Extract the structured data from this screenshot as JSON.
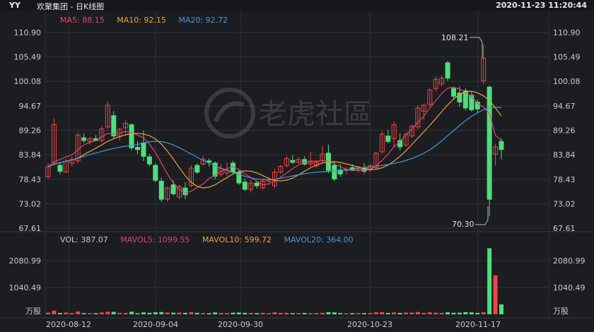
{
  "header": {
    "ticker": "YY",
    "name": "欢聚集团 - 日K线图",
    "datetime": "2020-11-23 11:20:44"
  },
  "price_legend": {
    "ma5": "MA5: 88.15",
    "ma10": "MA10: 92.15",
    "ma20": "MA20: 92.72"
  },
  "volume_legend": {
    "vol": "VOL: 387.07",
    "mavol5": "MAVOL5: 1099.55",
    "mavol10": "MAVOL10: 599.72",
    "mavol20": "MAVOL20: 364.00"
  },
  "watermark": "老虎社區",
  "price_axis": [
    "110.90",
    "105.49",
    "100.08",
    "94.67",
    "89.26",
    "83.84",
    "78.43",
    "73.02",
    "67.61"
  ],
  "volume_axis": [
    "2080.99",
    "1040.49",
    "万股"
  ],
  "date_labels": [
    "2020-08-12",
    "2020-09-04",
    "2020-09-30",
    "2020-10-23",
    "2020-11-17"
  ],
  "annotations": {
    "high": "108.21",
    "low": "70.30"
  },
  "colors": {
    "up": "#ee4444",
    "down": "#4ae07a",
    "ma5": "#e0456f",
    "ma10": "#f0a13a",
    "ma20": "#3d9ae0",
    "grid": "#2e3036",
    "bg": "#1c1d21"
  },
  "chart_data": {
    "type": "candlestick",
    "price_ylim": [
      67.61,
      110.9
    ],
    "volume_ylim": [
      0,
      2600
    ],
    "candles": [
      {
        "o": 79.0,
        "h": 82.0,
        "l": 78.5,
        "c": 81.2
      },
      {
        "o": 82.0,
        "h": 91.8,
        "l": 81.5,
        "c": 90.5
      },
      {
        "o": 81.5,
        "h": 82.3,
        "l": 79.5,
        "c": 80.2
      },
      {
        "o": 80.0,
        "h": 83.0,
        "l": 79.8,
        "c": 82.4
      },
      {
        "o": 82.0,
        "h": 83.5,
        "l": 81.2,
        "c": 82.8
      },
      {
        "o": 82.5,
        "h": 88.8,
        "l": 82.0,
        "c": 88.2
      },
      {
        "o": 87.6,
        "h": 88.6,
        "l": 86.4,
        "c": 87.0
      },
      {
        "o": 86.8,
        "h": 87.8,
        "l": 86.1,
        "c": 87.4
      },
      {
        "o": 87.4,
        "h": 88.2,
        "l": 86.8,
        "c": 87.0
      },
      {
        "o": 87.0,
        "h": 90.2,
        "l": 86.5,
        "c": 89.6
      },
      {
        "o": 90.0,
        "h": 95.6,
        "l": 89.5,
        "c": 94.8
      },
      {
        "o": 92.5,
        "h": 93.5,
        "l": 87.3,
        "c": 88.0
      },
      {
        "o": 88.0,
        "h": 89.8,
        "l": 87.0,
        "c": 89.5
      },
      {
        "o": 89.8,
        "h": 91.6,
        "l": 88.3,
        "c": 90.8
      },
      {
        "o": 90.5,
        "h": 90.8,
        "l": 84.8,
        "c": 85.4
      },
      {
        "o": 85.5,
        "h": 86.8,
        "l": 84.0,
        "c": 85.0
      },
      {
        "o": 86.5,
        "h": 89.2,
        "l": 82.5,
        "c": 83.5
      },
      {
        "o": 83.4,
        "h": 84.0,
        "l": 81.3,
        "c": 81.8
      },
      {
        "o": 81.5,
        "h": 82.0,
        "l": 77.8,
        "c": 78.2
      },
      {
        "o": 78.0,
        "h": 78.8,
        "l": 73.4,
        "c": 74.0
      },
      {
        "o": 74.0,
        "h": 76.8,
        "l": 73.4,
        "c": 76.5
      },
      {
        "o": 77.2,
        "h": 78.2,
        "l": 74.8,
        "c": 75.2
      },
      {
        "o": 74.5,
        "h": 77.2,
        "l": 74.0,
        "c": 76.8
      },
      {
        "o": 76.5,
        "h": 77.8,
        "l": 74.0,
        "c": 75.0
      },
      {
        "o": 77.0,
        "h": 81.6,
        "l": 76.6,
        "c": 80.9
      },
      {
        "o": 81.5,
        "h": 82.0,
        "l": 79.6,
        "c": 80.0
      },
      {
        "o": 81.8,
        "h": 83.6,
        "l": 81.4,
        "c": 82.8
      },
      {
        "o": 82.5,
        "h": 83.0,
        "l": 81.2,
        "c": 82.2
      },
      {
        "o": 82.0,
        "h": 82.4,
        "l": 78.4,
        "c": 79.1
      },
      {
        "o": 79.5,
        "h": 81.8,
        "l": 79.0,
        "c": 80.8
      },
      {
        "o": 79.8,
        "h": 82.2,
        "l": 79.2,
        "c": 80.5
      },
      {
        "o": 82.0,
        "h": 82.5,
        "l": 79.5,
        "c": 80.0
      },
      {
        "o": 80.0,
        "h": 80.6,
        "l": 77.2,
        "c": 77.6
      },
      {
        "o": 77.8,
        "h": 78.6,
        "l": 75.8,
        "c": 76.2
      },
      {
        "o": 76.2,
        "h": 78.4,
        "l": 75.5,
        "c": 77.6
      },
      {
        "o": 77.6,
        "h": 78.0,
        "l": 76.4,
        "c": 77.0
      },
      {
        "o": 76.5,
        "h": 78.6,
        "l": 76.2,
        "c": 78.0
      },
      {
        "o": 78.0,
        "h": 78.9,
        "l": 77.2,
        "c": 78.3
      },
      {
        "o": 77.0,
        "h": 80.8,
        "l": 76.4,
        "c": 80.0
      },
      {
        "o": 80.0,
        "h": 81.6,
        "l": 79.5,
        "c": 81.3
      },
      {
        "o": 81.5,
        "h": 83.6,
        "l": 81.0,
        "c": 83.0
      },
      {
        "o": 82.6,
        "h": 83.8,
        "l": 81.8,
        "c": 82.2
      },
      {
        "o": 82.2,
        "h": 83.3,
        "l": 81.9,
        "c": 82.8
      },
      {
        "o": 82.8,
        "h": 83.5,
        "l": 81.4,
        "c": 81.8
      },
      {
        "o": 81.8,
        "h": 84.5,
        "l": 81.2,
        "c": 82.2
      },
      {
        "o": 81.5,
        "h": 82.6,
        "l": 81.0,
        "c": 82.2
      },
      {
        "o": 82.5,
        "h": 85.8,
        "l": 82.0,
        "c": 84.0
      },
      {
        "o": 84.2,
        "h": 86.1,
        "l": 79.8,
        "c": 80.4
      },
      {
        "o": 81.5,
        "h": 82.5,
        "l": 78.0,
        "c": 78.5
      },
      {
        "o": 80.5,
        "h": 81.8,
        "l": 79.0,
        "c": 79.6
      },
      {
        "o": 80.4,
        "h": 81.2,
        "l": 79.5,
        "c": 80.6
      },
      {
        "o": 81.0,
        "h": 81.8,
        "l": 80.2,
        "c": 80.4
      },
      {
        "o": 80.5,
        "h": 81.4,
        "l": 79.9,
        "c": 81.1
      },
      {
        "o": 81.0,
        "h": 82.0,
        "l": 79.6,
        "c": 80.2
      },
      {
        "o": 80.5,
        "h": 81.8,
        "l": 80.0,
        "c": 81.4
      },
      {
        "o": 81.0,
        "h": 84.5,
        "l": 80.6,
        "c": 84.2
      },
      {
        "o": 84.5,
        "h": 89.0,
        "l": 84.0,
        "c": 88.4
      },
      {
        "o": 88.0,
        "h": 89.4,
        "l": 86.4,
        "c": 86.8
      },
      {
        "o": 87.4,
        "h": 91.2,
        "l": 85.6,
        "c": 90.5
      },
      {
        "o": 87.0,
        "h": 88.6,
        "l": 84.8,
        "c": 85.6
      },
      {
        "o": 86.0,
        "h": 88.8,
        "l": 85.6,
        "c": 88.4
      },
      {
        "o": 88.0,
        "h": 90.5,
        "l": 87.5,
        "c": 90.2
      },
      {
        "o": 90.0,
        "h": 94.8,
        "l": 89.5,
        "c": 94.2
      },
      {
        "o": 93.5,
        "h": 95.2,
        "l": 91.5,
        "c": 94.8
      },
      {
        "o": 95.0,
        "h": 98.5,
        "l": 94.5,
        "c": 98.2
      },
      {
        "o": 98.5,
        "h": 101.2,
        "l": 97.8,
        "c": 100.5
      },
      {
        "o": 99.5,
        "h": 101.5,
        "l": 99.0,
        "c": 100.8
      },
      {
        "o": 104.2,
        "h": 104.6,
        "l": 100.2,
        "c": 100.8
      },
      {
        "o": 98.5,
        "h": 98.8,
        "l": 96.3,
        "c": 96.8
      },
      {
        "o": 97.5,
        "h": 99.0,
        "l": 94.5,
        "c": 95.5
      },
      {
        "o": 98.0,
        "h": 98.5,
        "l": 93.6,
        "c": 94.2
      },
      {
        "o": 97.0,
        "h": 97.8,
        "l": 93.4,
        "c": 93.8
      },
      {
        "o": 95.5,
        "h": 96.0,
        "l": 93.2,
        "c": 94.0
      },
      {
        "o": 100.2,
        "h": 108.21,
        "l": 99.5,
        "c": 105.2
      },
      {
        "o": 98.8,
        "h": 99.2,
        "l": 70.3,
        "c": 74.0
      },
      {
        "o": 84.0,
        "h": 86.3,
        "l": 81.5,
        "c": 85.6
      },
      {
        "o": 86.8,
        "h": 87.5,
        "l": 82.8,
        "c": 85.0
      }
    ],
    "ma5": [
      81.2,
      82.3,
      82.8,
      83.4,
      83.8,
      85.0,
      86.0,
      86.6,
      87.0,
      87.8,
      88.6,
      88.4,
      88.6,
      89.0,
      88.8,
      88.2,
      87.6,
      86.2,
      84.4,
      82.0,
      79.6,
      77.6,
      76.2,
      75.4,
      75.8,
      76.6,
      77.4,
      78.6,
      79.4,
      80.2,
      80.8,
      81.2,
      80.6,
      79.6,
      78.8,
      78.0,
      77.2,
      77.4,
      78.0,
      78.9,
      79.8,
      80.8,
      81.6,
      82.2,
      82.5,
      82.4,
      82.6,
      82.4,
      81.8,
      81.2,
      80.6,
      80.4,
      80.4,
      80.4,
      80.6,
      81.4,
      82.6,
      84.0,
      85.6,
      86.8,
      88.2,
      89.6,
      91.0,
      92.4,
      94.2,
      95.8,
      97.4,
      98.6,
      98.8,
      98.4,
      97.6,
      96.8,
      95.2,
      94.4,
      93.0,
      88.15,
      87.0
    ]
  }
}
